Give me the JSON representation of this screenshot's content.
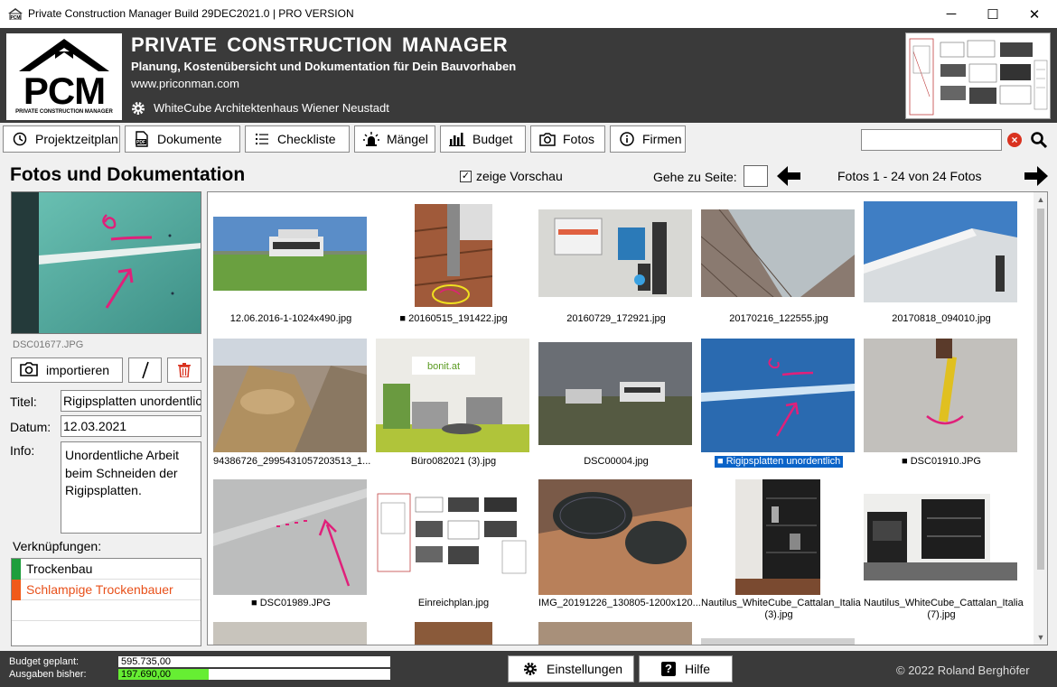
{
  "window": {
    "title": "Private Construction Manager Build 29DEC2021.0 | PRO VERSION",
    "min": "─",
    "max": "☐",
    "close": "✕"
  },
  "header": {
    "logo_text": "PCM",
    "logo_subtext": "PRIVATE CONSTRUCTION MANAGER",
    "title": "PRIVATE CONSTRUCTION MANAGER",
    "subtitle": "Planung, Kostenübersicht und Dokumentation für Dein Bauvorhaben",
    "url": "www.priconman.com",
    "project": "WhiteCube Architektenhaus Wiener Neustadt"
  },
  "toolbar": {
    "items": [
      {
        "label": "Projektzeitplan",
        "icon": "clock-icon"
      },
      {
        "label": "Dokumente",
        "icon": "pdf-icon"
      },
      {
        "label": "Checkliste",
        "icon": "list-icon"
      },
      {
        "label": "Mängel",
        "icon": "alarm-icon"
      },
      {
        "label": "Budget",
        "icon": "bar-chart-icon"
      },
      {
        "label": "Fotos",
        "icon": "camera-icon"
      },
      {
        "label": "Firmen",
        "icon": "info-icon"
      }
    ],
    "search_value": "",
    "clear_glyph": "×"
  },
  "section": {
    "title": "Fotos und Dokumentation",
    "preview_label": "zeige Vorschau",
    "preview_checked": true,
    "check_glyph": "✓",
    "goto_label": "Gehe zu Seite:",
    "goto_value": "",
    "page_info": "Fotos 1 - 24 von 24 Fotos"
  },
  "detail": {
    "file_name": "DSC01677.JPG",
    "import_label": "importieren",
    "title_label": "Titel:",
    "title_value": "Rigipsplatten unordentlich",
    "date_label": "Datum:",
    "date_value": "12.03.2021",
    "info_label": "Info:",
    "info_value": "Unordentliche Arbeit beim Schneiden der Rigipsplatten.",
    "links_label": "Verknüpfungen:",
    "links": [
      {
        "label": "Trockenbau",
        "color": "#1e9e3c",
        "text_color": "#000000"
      },
      {
        "label": "Schlampige Trockenbauer",
        "color": "#f05a1a",
        "text_color": "#e8501a"
      }
    ]
  },
  "gallery": {
    "photos": [
      {
        "caption": "12.06.2016-1-1024x490.jpg",
        "marked": false
      },
      {
        "caption": "■ 20160515_191422.jpg",
        "marked": true
      },
      {
        "caption": "20160729_172921.jpg",
        "marked": false
      },
      {
        "caption": "20170216_122555.jpg",
        "marked": false
      },
      {
        "caption": "20170818_094010.jpg",
        "marked": false
      },
      {
        "caption": "94386726_2995431057203513_1...",
        "marked": false
      },
      {
        "caption": "Büro082021 (3).jpg",
        "marked": false
      },
      {
        "caption": "DSC00004.jpg",
        "marked": false
      },
      {
        "caption": "■ Rigipsplatten unordentlich",
        "marked": true,
        "selected": true
      },
      {
        "caption": "■ DSC01910.JPG",
        "marked": true
      },
      {
        "caption": "■ DSC01989.JPG",
        "marked": true
      },
      {
        "caption": "Einreichplan.jpg",
        "marked": false
      },
      {
        "caption": "IMG_20191226_130805-1200x120...",
        "marked": false
      },
      {
        "caption": "Nautilus_WhiteCube_Cattalan_Italia (3).jpg",
        "marked": false
      },
      {
        "caption": "Nautilus_WhiteCube_Cattalan_Italia (7).jpg",
        "marked": false
      }
    ]
  },
  "footer": {
    "budget_label": "Budget  geplant:",
    "budget_value": "595.735,00",
    "spent_label": "Ausgaben bisher:",
    "spent_value": "197.690,00",
    "spent_fraction": 0.332,
    "settings_label": "Einstellungen",
    "help_label": "Hilfe",
    "copyright": "© 2022 Roland Berghöfer"
  }
}
